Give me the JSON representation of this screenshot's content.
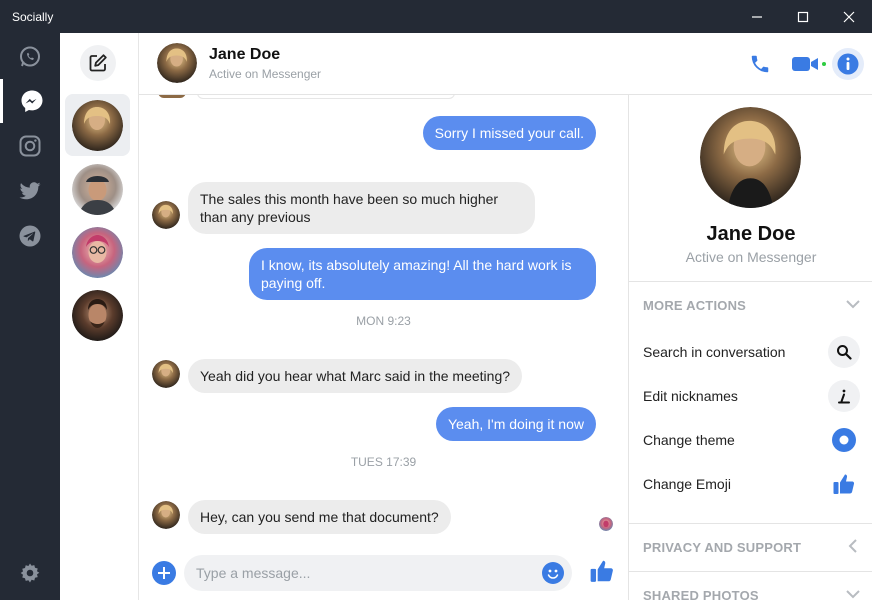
{
  "window": {
    "title": "Socially"
  },
  "colors": {
    "accent": "#5b8def",
    "rail": "#242a35",
    "incoming": "#ececec",
    "online": "#2ecc40"
  },
  "rail": {
    "items": [
      {
        "icon": "whatsapp-icon"
      },
      {
        "icon": "messenger-icon",
        "active": true
      },
      {
        "icon": "instagram-icon"
      },
      {
        "icon": "twitter-icon"
      },
      {
        "icon": "telegram-icon"
      }
    ],
    "settings_icon": "gear-icon"
  },
  "contacts": {
    "compose_icon": "compose-icon",
    "items": [
      {
        "avatar": "avatar-jane",
        "active": true
      },
      {
        "avatar": "avatar-cap"
      },
      {
        "avatar": "avatar-glasses"
      },
      {
        "avatar": "avatar-man"
      }
    ]
  },
  "header": {
    "name": "Jane Doe",
    "status": "Active on Messenger"
  },
  "messages": [
    {
      "dir": "out",
      "text": "Sorry I missed your call."
    },
    {
      "dir": "in",
      "text": "The sales this month have been so much higher than any previous"
    },
    {
      "dir": "out",
      "text": "I know, its absolutely amazing! All the hard work is paying off."
    },
    {
      "type": "stamp",
      "text": "MON 9:23"
    },
    {
      "dir": "in",
      "text": "Yeah did you hear what Marc said in the meeting?"
    },
    {
      "dir": "out",
      "text": "Yeah, I'm doing it now"
    },
    {
      "type": "stamp",
      "text": "TUES 17:39"
    },
    {
      "dir": "in",
      "text": "Hey, can you send me that document?"
    }
  ],
  "composer": {
    "placeholder": "Type a message..."
  },
  "panel": {
    "name": "Jane Doe",
    "status": "Active on Messenger",
    "more_actions": "MORE ACTIONS",
    "actions": [
      {
        "label": "Search in conversation",
        "icon": "search-icon"
      },
      {
        "label": "Edit nicknames",
        "icon": "pen-icon"
      },
      {
        "label": "Change theme",
        "icon": "theme-icon"
      },
      {
        "label": "Change Emoji",
        "icon": "thumbs-up-icon"
      }
    ],
    "privacy": "PRIVACY AND SUPPORT",
    "shared_photos": "SHARED PHOTOS"
  }
}
